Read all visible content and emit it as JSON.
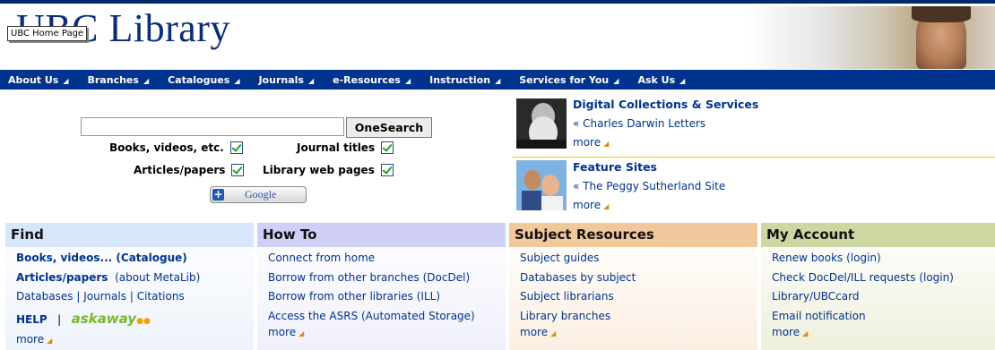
{
  "header": {
    "logo_text": "UBC Library",
    "tooltip": "UBC Home Page"
  },
  "nav": {
    "items": [
      "About Us",
      "Branches",
      "Catalogues",
      "Journals",
      "e-Resources",
      "Instruction",
      "Services for You",
      "Ask Us"
    ]
  },
  "search": {
    "value": "",
    "button_label": "OneSearch",
    "options": [
      {
        "label": "Books, videos, etc.",
        "checked": true
      },
      {
        "label": "Journal titles",
        "checked": true
      },
      {
        "label": "Articles/papers",
        "checked": true
      },
      {
        "label": "Library web pages",
        "checked": true
      }
    ],
    "google_label": "Google"
  },
  "features": [
    {
      "title": "Digital Collections & Services",
      "link": "« Charles Darwin Letters",
      "more": "more"
    },
    {
      "title": "Feature Sites",
      "link": "« The Peggy Sutherland Site",
      "more": "more"
    }
  ],
  "columns": {
    "find": {
      "title": "Find",
      "items": {
        "books": "Books, videos... (Catalogue)",
        "articles": "Articles/papers",
        "about": "(about MetaLib)",
        "databases": "Databases",
        "sep": "|",
        "journals": "Journals",
        "citations": "Citations",
        "help": "HELP",
        "askaway": "askaway"
      },
      "more": "more"
    },
    "howto": {
      "title": "How To",
      "items": [
        "Connect from home",
        "Borrow from other branches (DocDel)",
        "Borrow from other libraries (ILL)",
        "Access the ASRS (Automated Storage)"
      ],
      "more": "more"
    },
    "subject": {
      "title": "Subject Resources",
      "items": [
        "Subject guides",
        "Databases by subject",
        "Subject librarians",
        "Library branches"
      ],
      "more": "more"
    },
    "account": {
      "title": "My Account",
      "items": [
        "Renew books (login)",
        "Check DocDel/ILL requests (login)",
        "Library/UBCcard",
        "Email notification"
      ],
      "more": "more"
    }
  },
  "colors": {
    "nav_bg": "#00338d",
    "link": "#00338d",
    "find_hdr": "#d7e6fa",
    "howto_hdr": "#d0d0f7",
    "subject_hdr": "#f1c89c",
    "account_hdr": "#cdd7a2"
  }
}
